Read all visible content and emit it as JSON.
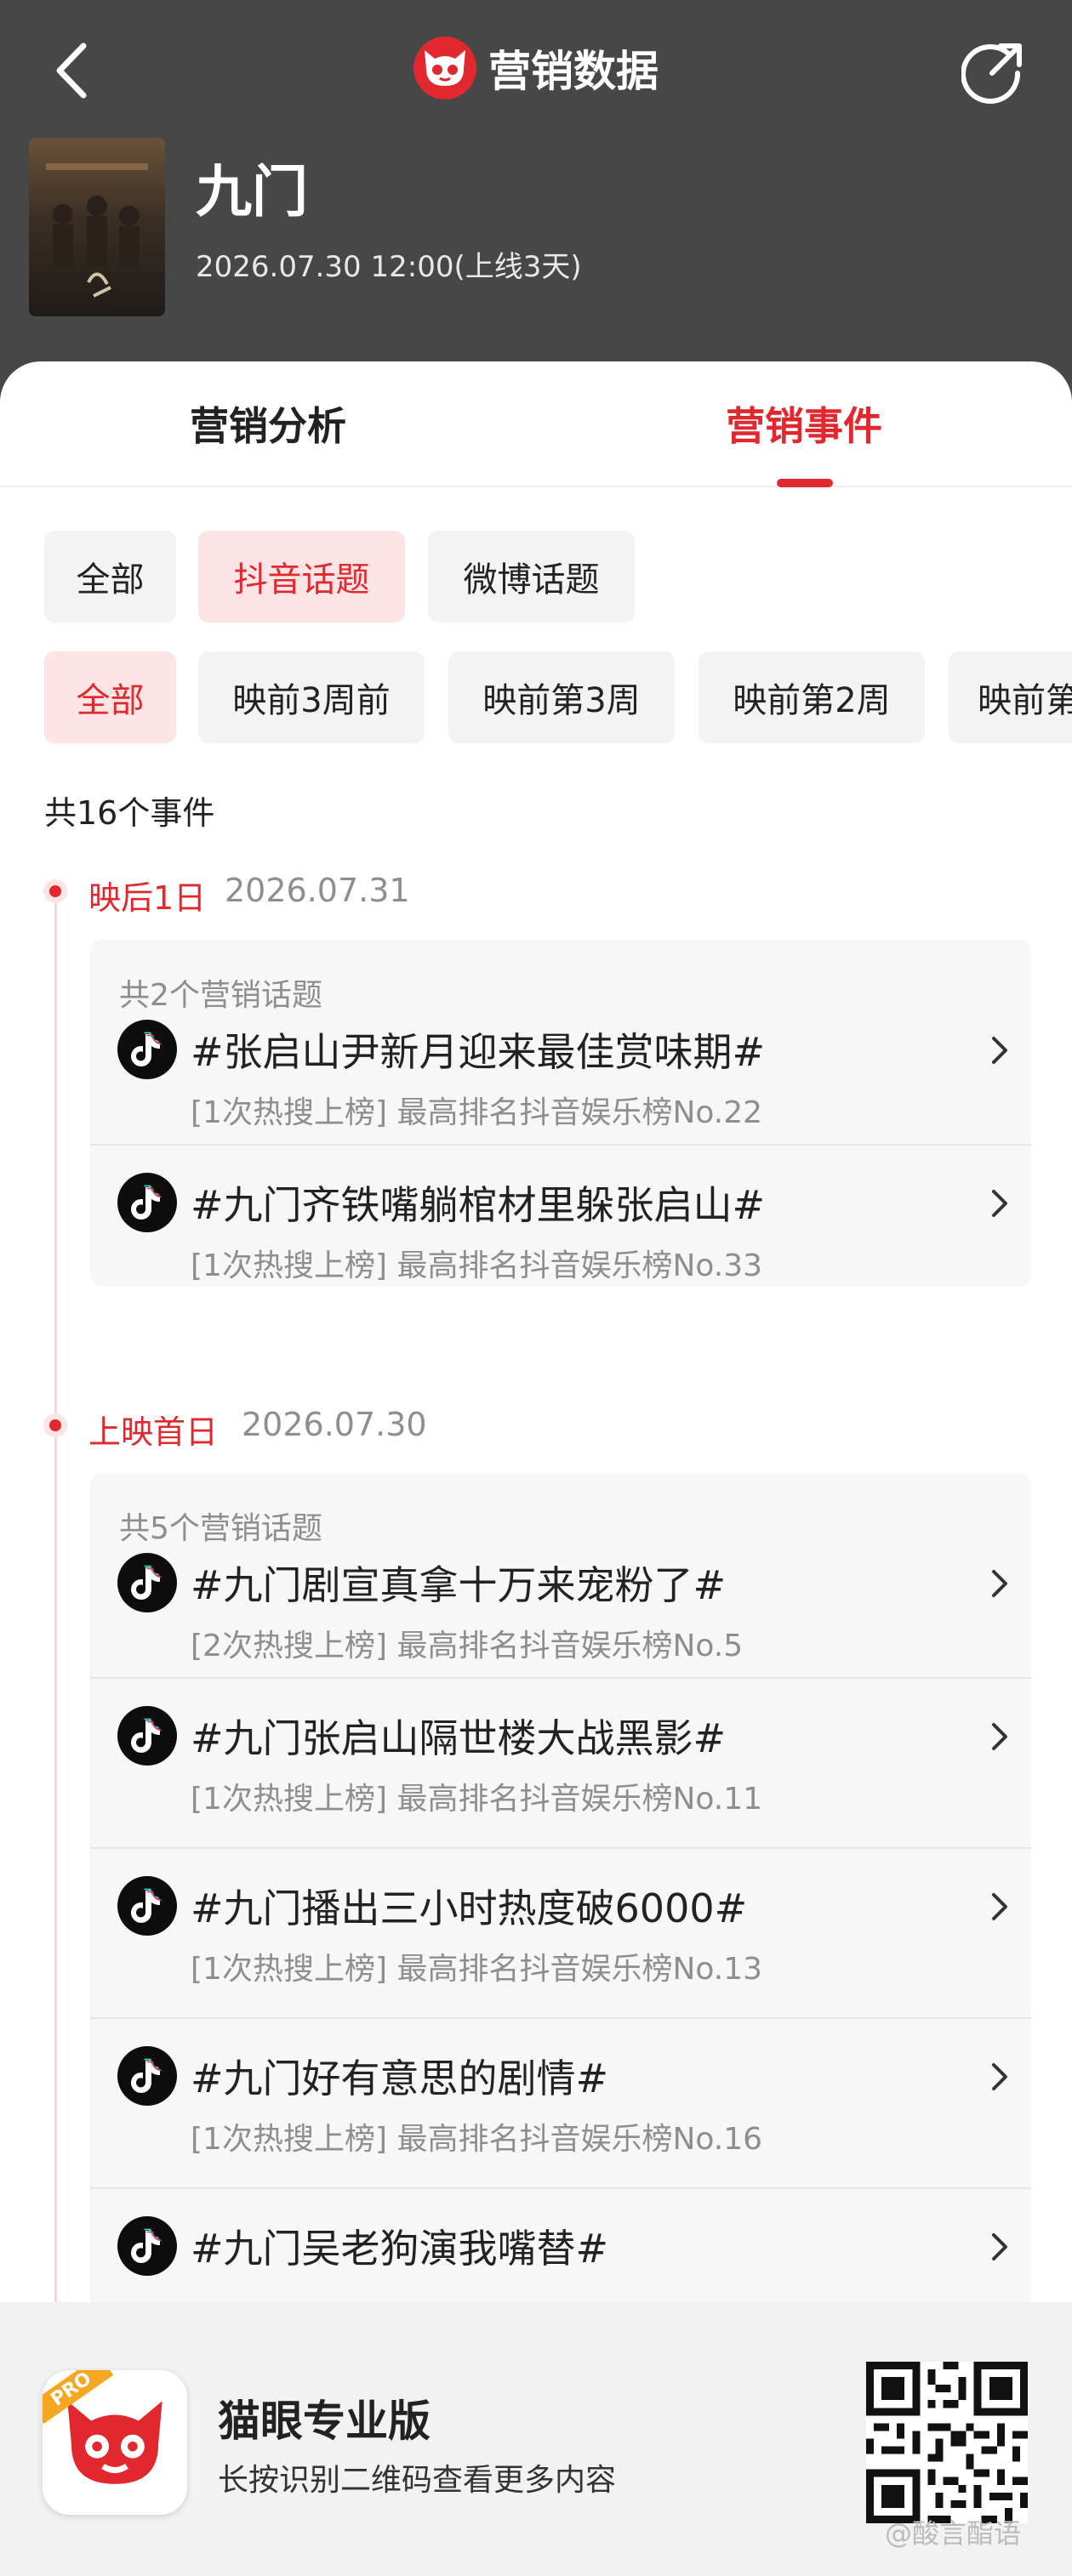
{
  "header": {
    "brand_title": "营销数据",
    "back_icon": "chevron-left-icon",
    "share_icon": "share-icon",
    "movie_title": "九门",
    "movie_date": "2026.07.30 12:00(上线3天)"
  },
  "tabs": [
    {
      "label": "营销分析",
      "active": false
    },
    {
      "label": "营销事件",
      "active": true
    }
  ],
  "filters_platform": [
    {
      "label": "全部",
      "active": false
    },
    {
      "label": "抖音话题",
      "active": true
    },
    {
      "label": "微博话题",
      "active": false
    }
  ],
  "filters_period": [
    {
      "label": "全部",
      "active": true
    },
    {
      "label": "映前3周前",
      "active": false
    },
    {
      "label": "映前第3周",
      "active": false
    },
    {
      "label": "映前第2周",
      "active": false
    },
    {
      "label": "映前第",
      "active": false
    }
  ],
  "total_label": "共16个事件",
  "groups": [
    {
      "day": "映后1日",
      "date": "2026.07.31",
      "count_label": "共2个营销话题",
      "items": [
        {
          "title": "#张启山尹新月迎来最佳赏味期#",
          "sub": "[1次热搜上榜] 最高排名抖音娱乐榜No.22"
        },
        {
          "title": "#九门齐铁嘴躺棺材里躲张启山#",
          "sub": "[1次热搜上榜] 最高排名抖音娱乐榜No.33"
        }
      ]
    },
    {
      "day": "上映首日",
      "date": "2026.07.30",
      "count_label": "共5个营销话题",
      "items": [
        {
          "title": "#九门剧宣真拿十万来宠粉了#",
          "sub": "[2次热搜上榜] 最高排名抖音娱乐榜No.5"
        },
        {
          "title": "#九门张启山隔世楼大战黑影#",
          "sub": "[1次热搜上榜] 最高排名抖音娱乐榜No.11"
        },
        {
          "title": "#九门播出三小时热度破6000#",
          "sub": "[1次热搜上榜] 最高排名抖音娱乐榜No.13"
        },
        {
          "title": "#九门好有意思的剧情#",
          "sub": "[1次热搜上榜] 最高排名抖音娱乐榜No.16"
        },
        {
          "title": "#九门吴老狗演我嘴替#",
          "sub": ""
        }
      ]
    }
  ],
  "footer": {
    "app_badge": "PRO",
    "title": "猫眼专业版",
    "subtitle": "长按识别二维码查看更多内容"
  },
  "watermark": "@酸言酯语",
  "colors": {
    "accent": "#e0282e",
    "header_bg": "#474747",
    "chip_active_bg": "#fde4e5"
  }
}
